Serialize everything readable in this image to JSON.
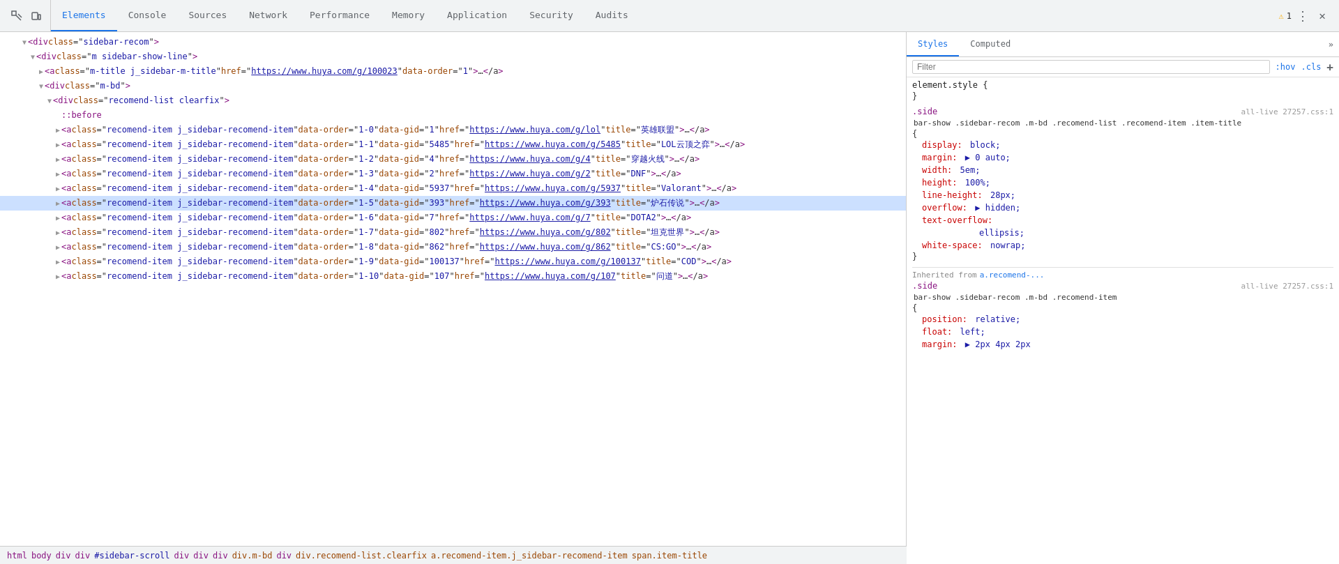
{
  "tabs": {
    "items": [
      {
        "label": "Elements",
        "active": true
      },
      {
        "label": "Console",
        "active": false
      },
      {
        "label": "Sources",
        "active": false
      },
      {
        "label": "Network",
        "active": false
      },
      {
        "label": "Performance",
        "active": false
      },
      {
        "label": "Memory",
        "active": false
      },
      {
        "label": "Application",
        "active": false
      },
      {
        "label": "Security",
        "active": false
      },
      {
        "label": "Audits",
        "active": false
      }
    ],
    "warning_badge": "⚠ 1"
  },
  "styles_panel": {
    "tabs": [
      {
        "label": "Styles",
        "active": true
      },
      {
        "label": "Computed",
        "active": false
      }
    ],
    "filter_placeholder": "Filter",
    "filter_hov": ":hov",
    "filter_cls": ".cls",
    "filter_plus": "+",
    "rules": [
      {
        "selector": "element.style {",
        "closing": "}",
        "props": []
      },
      {
        "selector": ".side all-live 27257.css:1",
        "selector_text": ".side",
        "file": "all-live 27257.css:1",
        "full_selector": "bar-show .sidebar-recom .m-bd .recomend-list .recomend-item .item-title",
        "opening": "{",
        "closing": "}",
        "props": [
          {
            "name": "display:",
            "value": "block;"
          },
          {
            "name": "margin:",
            "value": "▶ 0 auto;"
          },
          {
            "name": "width:",
            "value": "5em;"
          },
          {
            "name": "height:",
            "value": "100%;"
          },
          {
            "name": "line-height:",
            "value": "28px;"
          },
          {
            "name": "overflow:",
            "value": "▶ hidden;"
          },
          {
            "name": "text-overflow:",
            "value": ""
          },
          {
            "name": "",
            "value": "ellipsis;"
          },
          {
            "name": "white-space:",
            "value": "nowrap;"
          }
        ]
      }
    ],
    "inherited_label": "Inherited from",
    "inherited_source": "a.recomend-...",
    "inherited_rule": {
      "selector_text": ".side",
      "file": "all-live 27257.css:1",
      "full_selector": "bar-show .sidebar-recom .m-bd .recomend-item",
      "opening": "{",
      "closing": "}",
      "props": [
        {
          "name": "position:",
          "value": "relative;",
          "color": "normal"
        },
        {
          "name": "float:",
          "value": "left;",
          "color": "normal"
        },
        {
          "name": "margin:",
          "value": "▶ 2px 4px 2px",
          "color": "normal"
        }
      ]
    }
  },
  "dom_lines": [
    {
      "indent": 24,
      "arrow": "▼",
      "content": "&lt;div class=\"sidebar-recom\"&gt;",
      "tag": "div",
      "class": "sidebar-recom"
    },
    {
      "indent": 36,
      "arrow": "▼",
      "content": "&lt;div class=\"m sidebar-show-line\"&gt;",
      "tag": "div",
      "class": "m sidebar-show-line"
    },
    {
      "indent": 48,
      "arrow": "▶",
      "content": "&lt;a class=\"m-title j_sidebar-m-title\" href=\"https://www.huya.com/g/100023\" data-order=\"1\"&gt;…&lt;/a&gt;"
    },
    {
      "indent": 48,
      "arrow": "▼",
      "content": "&lt;div class=\"m-bd\"&gt;",
      "tag": "div",
      "class": "m-bd"
    },
    {
      "indent": 60,
      "arrow": "▼",
      "content": "&lt;div class=\"recomend-list clearfix\"&gt;",
      "tag": "div",
      "class": "recomend-list clearfix"
    },
    {
      "indent": 72,
      "content": "::before",
      "pseudo": true
    },
    {
      "indent": 72,
      "arrow": "▶",
      "content": "&lt;a class=\"recomend-item j_sidebar-recomend-item \" data-order=\"1-0\" data-gid=\"1\" href=\"https://www.huya.com/g/lol\" title=\"英雄联盟\"&gt;…&lt;/a&gt;"
    },
    {
      "indent": 72,
      "arrow": "▶",
      "content": "&lt;a class=\"recomend-item j_sidebar-recomend-item \" data-order=\"1-1\" data-gid=\"5485\" href=\"https://www.huya.com/g/5485\" title=\"LOL云顶之弈\"&gt;…&lt;/a&gt;"
    },
    {
      "indent": 72,
      "arrow": "▶",
      "content": "&lt;a class=\"recomend-item j_sidebar-recomend-item \" data-order=\"1-2\" data-gid=\"4\" href=\"https://www.huya.com/g/4\" title=\"穿越火线\"&gt;…&lt;/a&gt;"
    },
    {
      "indent": 72,
      "arrow": "▶",
      "content": "&lt;a class=\"recomend-item j_sidebar-recomend-item \" data-order=\"1-3\" data-gid=\"2\" href=\"https://www.huya.com/g/2\" title=\"DNF\"&gt;…&lt;/a&gt;"
    },
    {
      "indent": 72,
      "arrow": "▶",
      "content": "&lt;a class=\"recomend-item j_sidebar-recomend-item \" data-order=\"1-4\" data-gid=\"5937\" href=\"https://www.huya.com/g/5937\" title=\"Valorant\"&gt;…&lt;/a&gt;"
    },
    {
      "indent": 72,
      "arrow": "▶",
      "content": "&lt;a class=\"recomend-item j_sidebar-recomend-item \" data-order=\"1-5\" data-gid=\"393\" href=\"https://www.huya.com/g/393\" title=\"炉石传说\"&gt;…&lt;/a&gt;",
      "selected": true
    },
    {
      "indent": 72,
      "arrow": "▶",
      "content": "&lt;a class=\"recomend-item j_sidebar-recomend-item \" data-order=\"1-6\" data-gid=\"7\" href=\"https://www.huya.com/g/7\" title=\"DOTA2\"&gt;…&lt;/a&gt;"
    },
    {
      "indent": 72,
      "arrow": "▶",
      "content": "&lt;a class=\"recomend-item j_sidebar-recomend-item \" data-order=\"1-7\" data-gid=\"802\" href=\"https://www.huya.com/g/802\" title=\"坦克世界\"&gt;…&lt;/a&gt;"
    },
    {
      "indent": 72,
      "arrow": "▶",
      "content": "&lt;a class=\"recomend-item j_sidebar-recomend-item \" data-order=\"1-8\" data-gid=\"862\" href=\"https://www.huya.com/g/862\" title=\"CS:GO\"&gt;…&lt;/a&gt;"
    },
    {
      "indent": 72,
      "arrow": "▶",
      "content": "&lt;a class=\"recomend-item j_sidebar-recomend-item \" data-order=\"1-9\" data-gid=\"100137\" href=\"https://www.huya.com/g/100137\" title=\"COD\"&gt;…&lt;/a&gt;"
    },
    {
      "indent": 72,
      "arrow": "▶",
      "content": "&lt;a class=\"recomend-item j_sidebar-recomend-item \" data-order=\"1-10\" data-gid=\"107\" href=\"https://www.huya.com/g/107\" title=\"问道\"&gt;…&lt;/a&gt;"
    }
  ],
  "breadcrumb": {
    "items": [
      {
        "text": "html",
        "type": "tag"
      },
      {
        "text": "body",
        "type": "tag"
      },
      {
        "text": "div",
        "type": "tag"
      },
      {
        "text": "div",
        "type": "tag"
      },
      {
        "text": "#sidebar-scroll",
        "type": "id"
      },
      {
        "text": "div",
        "type": "tag"
      },
      {
        "text": "div",
        "type": "tag"
      },
      {
        "text": "div",
        "type": "tag"
      },
      {
        "text": "div.m-bd",
        "type": "class"
      },
      {
        "text": "div",
        "type": "tag"
      },
      {
        "text": "div.recomend-list.clearfix",
        "type": "class"
      },
      {
        "text": "a.recomend-item.j_sidebar-recomend-item",
        "type": "class"
      },
      {
        "text": "span.item-title",
        "type": "class"
      }
    ]
  }
}
